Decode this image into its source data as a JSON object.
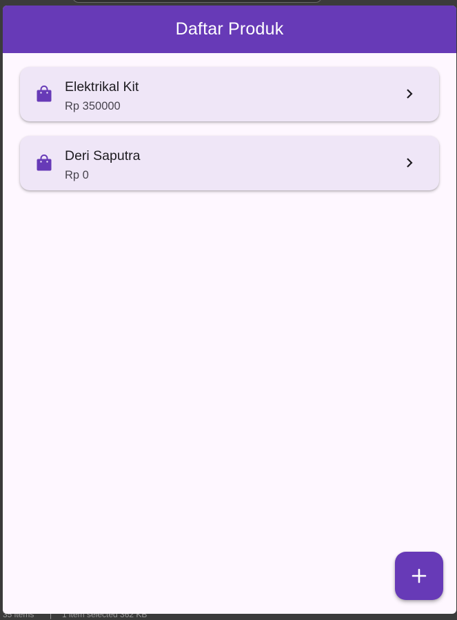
{
  "app": {
    "title": "Daftar Produk",
    "accent_color": "#673ab7",
    "background_color": "#fef7ff",
    "card_color": "#efe6f7"
  },
  "products": [
    {
      "name": "Elektrikal Kit",
      "price": "Rp 350000",
      "icon": "shopping-bag-icon",
      "trailing_icon": "chevron-right-icon"
    },
    {
      "name": "Deri Saputra",
      "price": "Rp 0",
      "icon": "shopping-bag-icon",
      "trailing_icon": "chevron-right-icon"
    }
  ],
  "fab": {
    "icon": "add-icon",
    "glyph": "+"
  },
  "statusbar": {
    "items_count": "35 items",
    "separator": "|",
    "selection": "1 item selected 362 KB"
  }
}
